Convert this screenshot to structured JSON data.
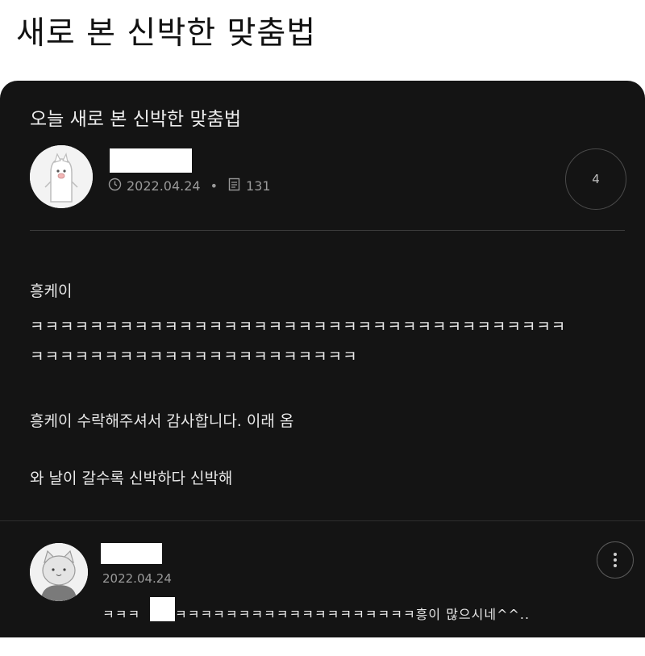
{
  "headline": "새로 본 신박한 맞춤법",
  "post": {
    "title": "오늘 새로 본 신박한 맞춤법",
    "date": "2022.04.24",
    "views": "131",
    "comment_count": "4",
    "body": {
      "line1": "흥케이",
      "line2": "ㅋㅋㅋㅋㅋㅋㅋㅋㅋㅋㅋㅋㅋㅋㅋㅋㅋㅋㅋㅋㅋㅋㅋㅋㅋㅋㅋㅋㅋㅋㅋㅋㅋㅋㅋㅋ",
      "line3": "ㅋㅋㅋㅋㅋㅋㅋㅋㅋㅋㅋㅋㅋㅋㅋㅋㅋㅋㅋㅋㅋㅋ",
      "line4": "흥케이 수락해주셔서 감사합니다. 이래 옴",
      "line5": "와 날이 갈수록 신박하다 신박해"
    }
  },
  "comment": {
    "date": "2022.04.24",
    "text_before": "ㅋㅋㅋ",
    "text_after": "ㅋㅋㅋㅋㅋㅋㅋㅋㅋㅋㅋㅋㅋㅋㅋㅋㅋㅋㅋ흥이 많으시네^^.."
  },
  "icons": {
    "clock": "clock-icon",
    "views": "document-icon",
    "more": "more-vertical-icon"
  },
  "colors": {
    "background": "#141414",
    "text": "#e8e8e8",
    "muted": "#9a9a9a"
  }
}
